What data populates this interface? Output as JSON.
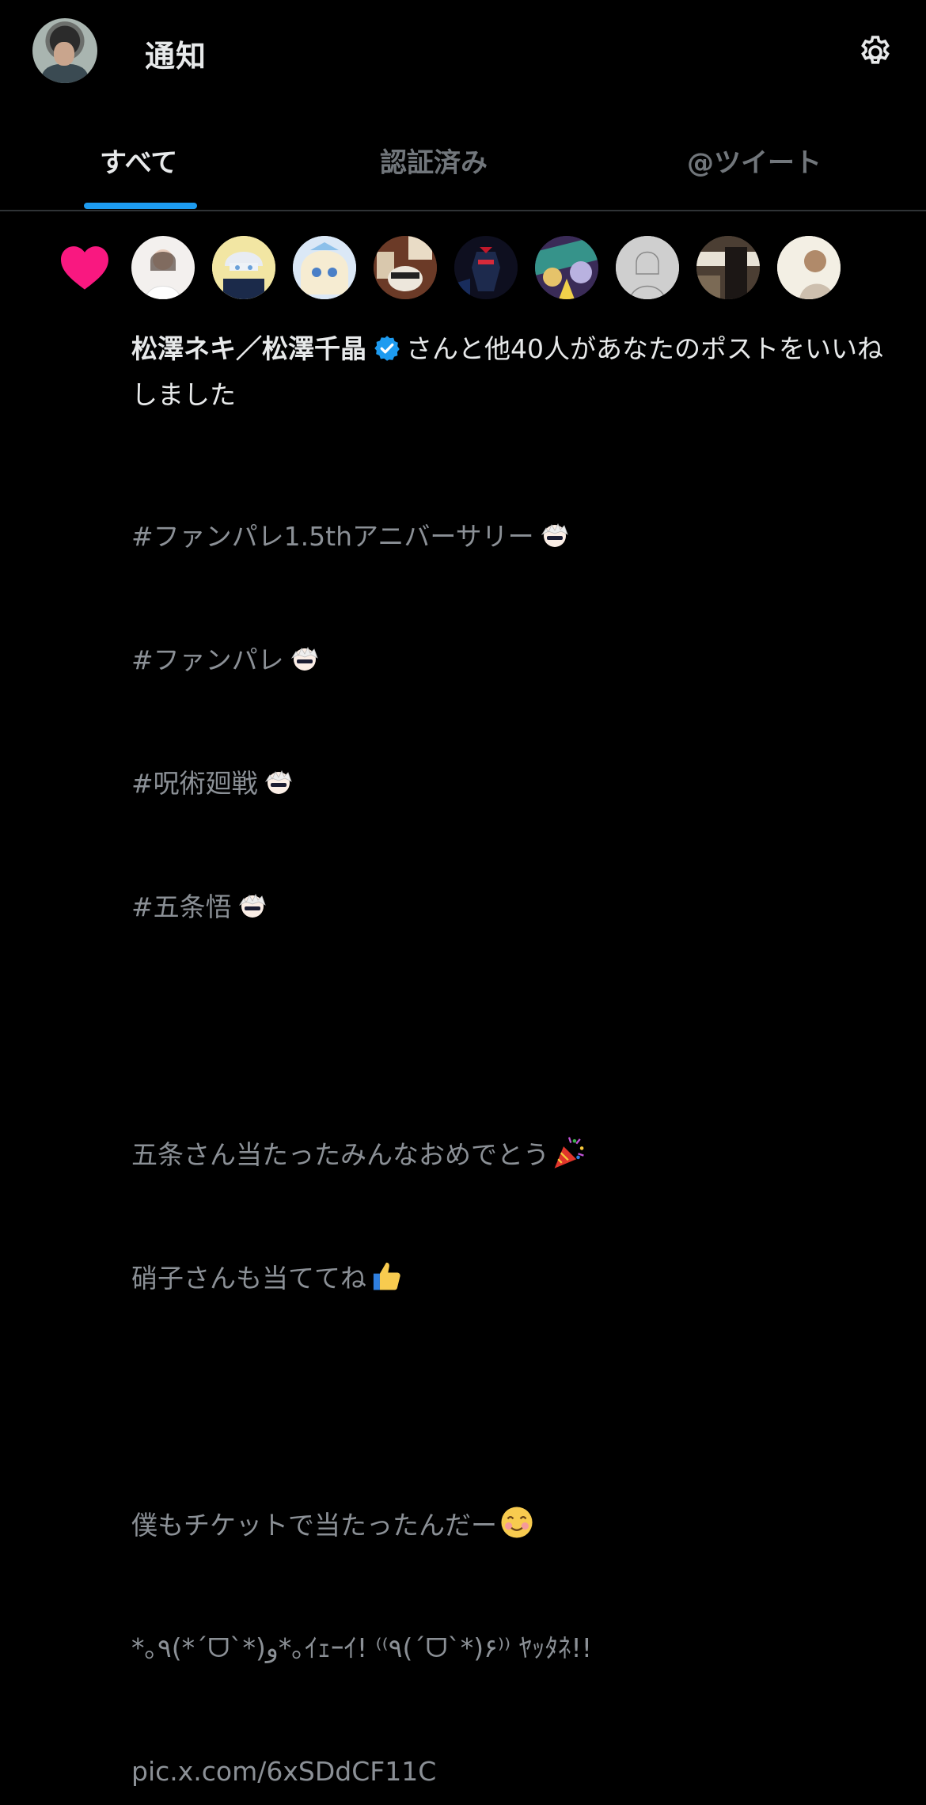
{
  "header": {
    "title": "通知"
  },
  "tabs": [
    {
      "label": "すべて",
      "active": true
    },
    {
      "label": "認証済み",
      "active": false
    },
    {
      "label": "@ツイート",
      "active": false
    }
  ],
  "notification": {
    "type": "like",
    "icon": "heart-icon",
    "icon_color": "#f91880",
    "liker_name": "松澤ネキ／松澤千晶",
    "verified": true,
    "summary_text": "さんと他40人があなたのポストをいいねしました",
    "tweet_lines": [
      "#ファンパレ1.5thアニバーサリー",
      "#ファンパレ",
      "#呪術廻戦",
      "#五条悟",
      "",
      "五条さん当たったみんなおめでとう",
      "硝子さんも当ててね",
      "",
      "僕もチケットで当たったんだー",
      "*｡٩(*ˊᗜˋ*)و*｡ｲｪｰｲ! ⁽⁽٩(ˊᗜˋ*)۶⁾⁾ ﾔｯﾀﾈ!!",
      "pic.x.com/6xSDdCF11C"
    ]
  },
  "colors": {
    "background": "#000000",
    "accent": "#1d9bf0",
    "like": "#f91880",
    "muted_text": "#8b9096"
  }
}
